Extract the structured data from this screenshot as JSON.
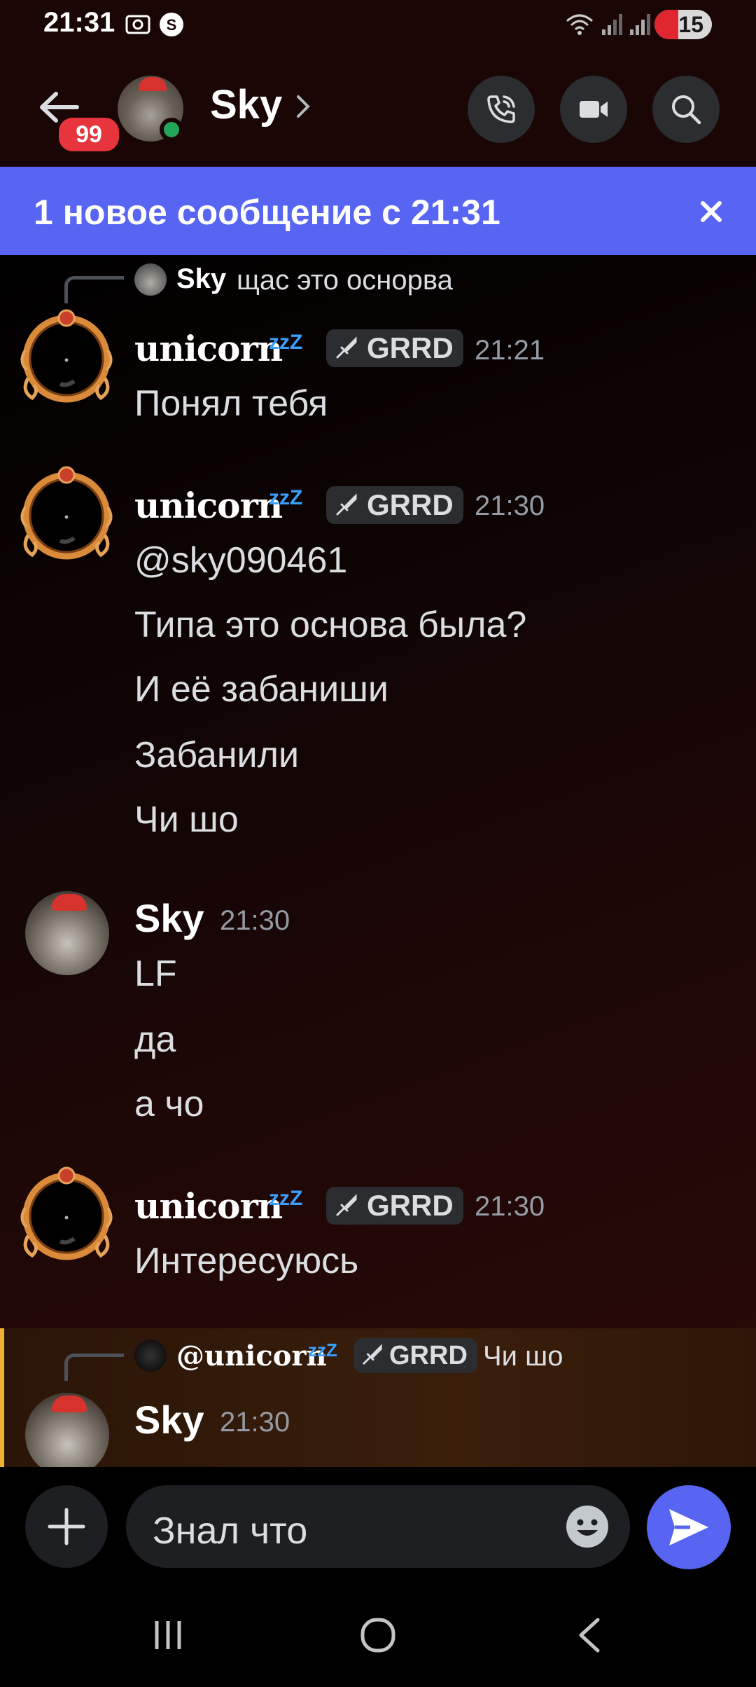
{
  "status_bar": {
    "time": "21:31",
    "battery": "15",
    "icons": [
      "screenshot-icon",
      "shazam-icon",
      "wifi-icon",
      "signal-icon",
      "signal-icon",
      "battery-icon"
    ]
  },
  "header": {
    "unread_count": "99",
    "title": "Sky",
    "icons": [
      "back-arrow-icon",
      "chevron-right-icon",
      "phone-call-icon",
      "video-camera-icon",
      "search-icon"
    ]
  },
  "banner": {
    "text": "1 новое сообщение с 21:31",
    "icons": [
      "close-icon"
    ]
  },
  "messages": [
    {
      "reply": {
        "author": "Sky",
        "text": "щас это оснорва"
      },
      "author": "unicorn",
      "status_suffix": "zzZ",
      "tag": "GRRD",
      "time": "21:21",
      "lines": [
        "Понял тебя"
      ]
    },
    {
      "author": "unicorn",
      "status_suffix": "zzZ",
      "tag": "GRRD",
      "time": "21:30",
      "lines": [
        "@sky090461",
        "Типа это основа была?",
        "И её забаниши",
        "Забанили",
        "Чи шо"
      ]
    },
    {
      "author": "Sky",
      "time": "21:30",
      "lines": [
        "LF",
        "да",
        "а чо"
      ]
    },
    {
      "author": "unicorn",
      "status_suffix": "zzZ",
      "tag": "GRRD",
      "time": "21:30",
      "lines": [
        "Интересуюсь"
      ]
    },
    {
      "reply": {
        "author": "@unicorn",
        "status_suffix": "zzZ",
        "tag": "GRRD",
        "text": "Чи шо"
      },
      "author": "Sky",
      "time": "21:30",
      "highlight_color": "#f0b232"
    }
  ],
  "composer": {
    "input_value": "Знал что",
    "icons": [
      "plus-icon",
      "emoji-icon",
      "send-icon"
    ]
  },
  "nav_bar": {
    "icons": [
      "recent-apps-icon",
      "home-icon",
      "back-icon"
    ]
  },
  "colors": {
    "accent": "#5865f2",
    "online": "#23a55a",
    "badge": "#e8343c",
    "mention_bar": "#f0b232",
    "zzz": "#3aa0ff"
  }
}
